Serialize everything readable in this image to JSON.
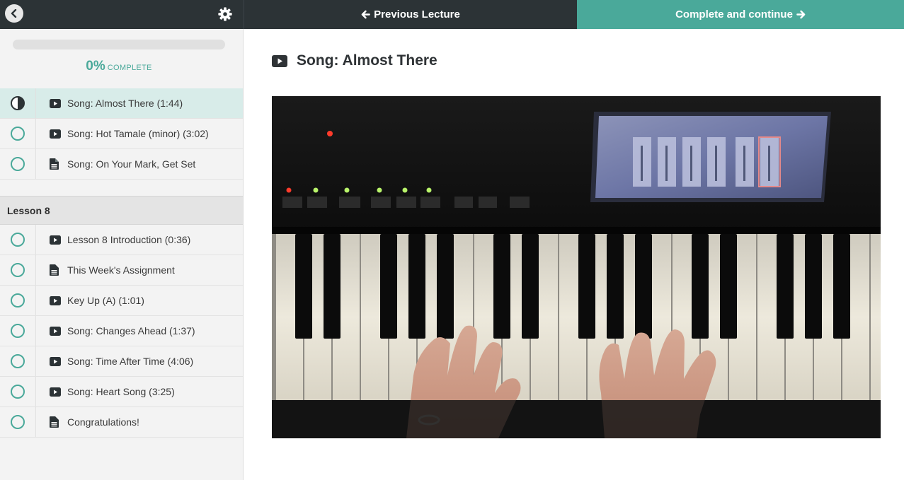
{
  "nav": {
    "previous_label": "Previous Lecture",
    "next_label": "Complete and continue"
  },
  "progress": {
    "percent_label": "0%",
    "complete_label": "COMPLETE",
    "fraction": 0
  },
  "sidebar": {
    "items_top": [
      {
        "title": "Song: Almost There (1:44)",
        "type": "video",
        "status": "in-progress",
        "active": true
      },
      {
        "title": "Song: Hot Tamale (minor) (3:02)",
        "type": "video",
        "status": "incomplete",
        "active": false
      },
      {
        "title": "Song: On Your Mark, Get Set",
        "type": "document",
        "status": "incomplete",
        "active": false
      }
    ],
    "section": {
      "title": "Lesson 8"
    },
    "items_section": [
      {
        "title": "Lesson 8 Introduction (0:36)",
        "type": "video",
        "status": "incomplete"
      },
      {
        "title": "This Week's Assignment",
        "type": "document",
        "status": "incomplete"
      },
      {
        "title": "Key Up (A) (1:01)",
        "type": "video",
        "status": "incomplete"
      },
      {
        "title": "Song: Changes Ahead (1:37)",
        "type": "video",
        "status": "incomplete"
      },
      {
        "title": "Song: Time After Time (4:06)",
        "type": "video",
        "status": "incomplete"
      },
      {
        "title": "Song: Heart Song (3:25)",
        "type": "video",
        "status": "incomplete"
      },
      {
        "title": "Congratulations!",
        "type": "document",
        "status": "incomplete"
      }
    ]
  },
  "lecture": {
    "title": "Song: Almost There"
  },
  "icons": {
    "back": "chevron-left-icon",
    "settings": "gear-icon",
    "prev": "arrow-left-icon",
    "next": "arrow-right-icon",
    "video": "video-icon",
    "document": "document-icon"
  },
  "colors": {
    "accent": "#4aa99a",
    "dark": "#2c3336",
    "active_row": "#d8ece9"
  }
}
